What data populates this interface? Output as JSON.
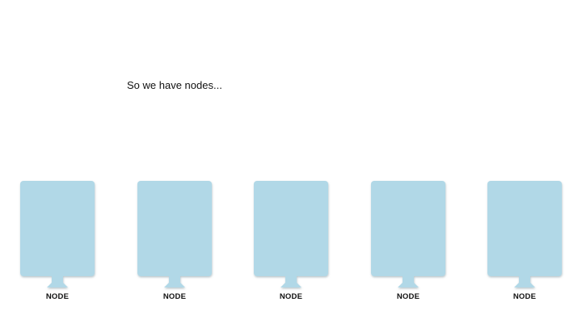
{
  "slide": {
    "caption": "So we have nodes..."
  },
  "nodes": [
    {
      "label": "NODE"
    },
    {
      "label": "NODE"
    },
    {
      "label": "NODE"
    },
    {
      "label": "NODE"
    },
    {
      "label": "NODE"
    }
  ],
  "colors": {
    "node_fill": "#b1d8e7",
    "node_shadow": "#9fb6c0",
    "text": "#111111",
    "background": "#ffffff"
  },
  "icons": {
    "node_shape": "monitor-icon"
  }
}
